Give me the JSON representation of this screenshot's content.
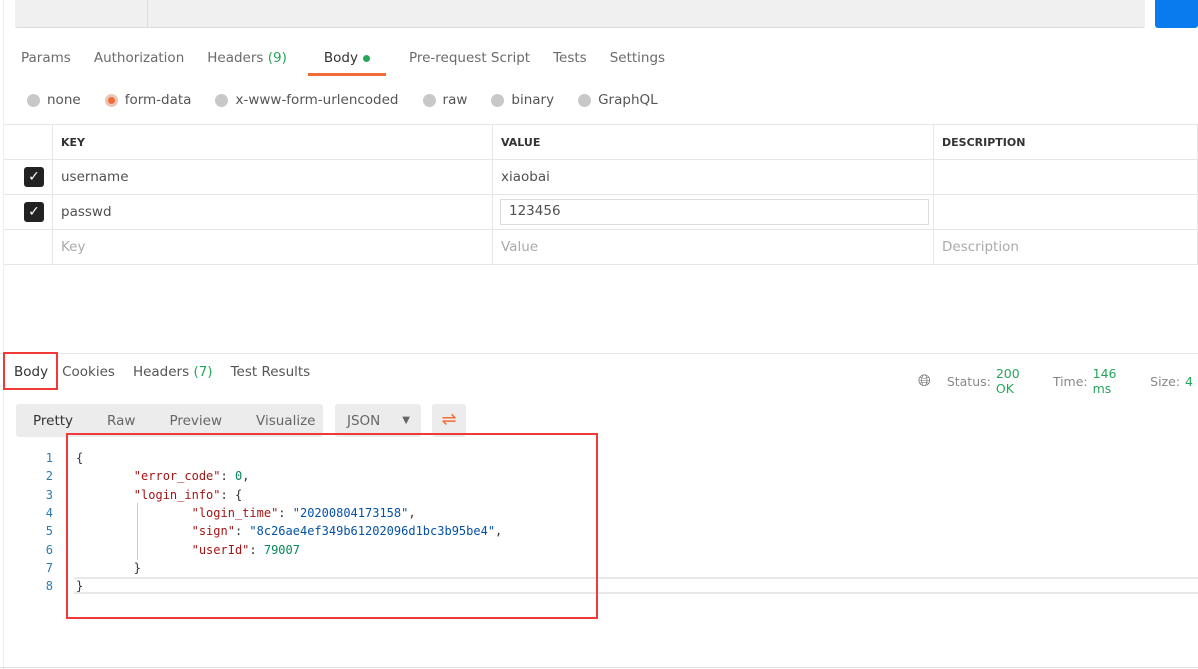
{
  "request_tabs": [
    {
      "label": "Params"
    },
    {
      "label": "Authorization"
    },
    {
      "label": "Headers",
      "count": "(9)"
    },
    {
      "label": "Body"
    },
    {
      "label": "Pre-request Script"
    },
    {
      "label": "Tests"
    },
    {
      "label": "Settings"
    }
  ],
  "body_types": [
    {
      "label": "none",
      "selected": false
    },
    {
      "label": "form-data",
      "selected": true
    },
    {
      "label": "x-www-form-urlencoded",
      "selected": false
    },
    {
      "label": "raw",
      "selected": false
    },
    {
      "label": "binary",
      "selected": false
    },
    {
      "label": "GraphQL",
      "selected": false
    }
  ],
  "table": {
    "headers": [
      "KEY",
      "VALUE",
      "DESCRIPTION"
    ],
    "rows": [
      {
        "key": "username",
        "value": "xiaobai",
        "checked": true
      },
      {
        "key": "passwd",
        "value": "123456",
        "checked": true
      }
    ],
    "placeholder": {
      "key": "Key",
      "value": "Value",
      "description": "Description"
    }
  },
  "response_tabs": [
    {
      "label": "Body"
    },
    {
      "label": "Cookies"
    },
    {
      "label": "Headers",
      "count": "(7)"
    },
    {
      "label": "Test Results"
    }
  ],
  "status": {
    "status_label": "Status:",
    "status_value": "200 OK",
    "time_label": "Time:",
    "time_value": "146 ms",
    "size_label": "Size:",
    "size_value": "4"
  },
  "view_modes": [
    "Pretty",
    "Raw",
    "Preview",
    "Visualize"
  ],
  "format": "JSON",
  "accent": "#f26b3a",
  "success": "#26a65b",
  "code_lines": [
    [
      [
        "p",
        "{"
      ]
    ],
    [
      [
        "p",
        "        "
      ],
      [
        "k",
        "\"error_code\""
      ],
      [
        "p",
        ": "
      ],
      [
        "n",
        "0"
      ],
      [
        "p",
        ","
      ]
    ],
    [
      [
        "p",
        "        "
      ],
      [
        "k",
        "\"login_info\""
      ],
      [
        "p",
        ": {"
      ]
    ],
    [
      [
        "p",
        "                "
      ],
      [
        "k",
        "\"login_time\""
      ],
      [
        "p",
        ": "
      ],
      [
        "s",
        "\"20200804173158\""
      ],
      [
        "p",
        ","
      ]
    ],
    [
      [
        "p",
        "                "
      ],
      [
        "k",
        "\"sign\""
      ],
      [
        "p",
        ": "
      ],
      [
        "s",
        "\"8c26ae4ef349b61202096d1bc3b95be4\""
      ],
      [
        "p",
        ","
      ]
    ],
    [
      [
        "p",
        "                "
      ],
      [
        "k",
        "\"userId\""
      ],
      [
        "p",
        ": "
      ],
      [
        "n",
        "79007"
      ]
    ],
    [
      [
        "p",
        "        }"
      ]
    ],
    [
      [
        "p",
        "}"
      ]
    ]
  ]
}
